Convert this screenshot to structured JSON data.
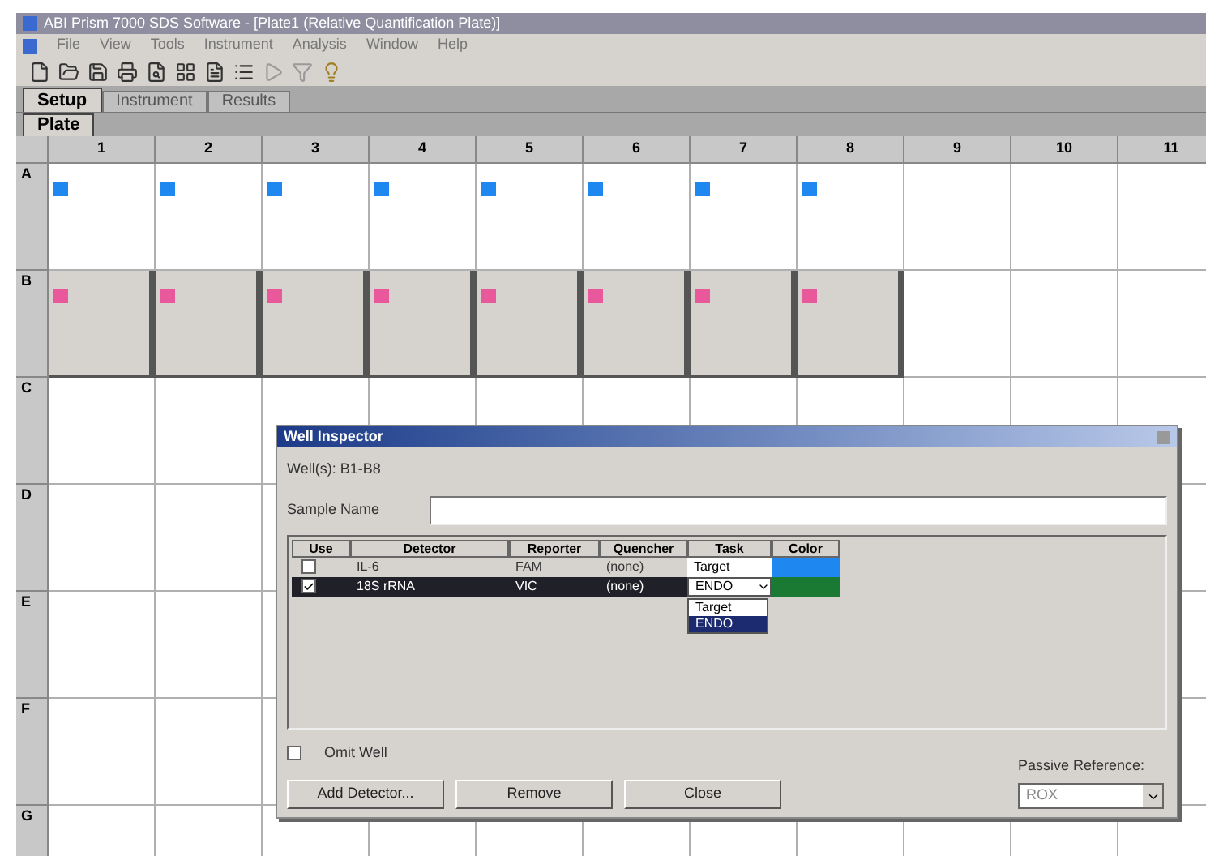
{
  "window": {
    "title": "ABI Prism 7000 SDS Software - [Plate1 (Relative Quantification Plate)]"
  },
  "menu": [
    "File",
    "View",
    "Tools",
    "Instrument",
    "Analysis",
    "Window",
    "Help"
  ],
  "tabs": [
    {
      "label": "Setup",
      "selected": true
    },
    {
      "label": "Instrument",
      "selected": false
    },
    {
      "label": "Results",
      "selected": false
    }
  ],
  "subtabs": [
    {
      "label": "Plate",
      "selected": true
    }
  ],
  "plate": {
    "columns": [
      "1",
      "2",
      "3",
      "4",
      "5",
      "6",
      "7",
      "8",
      "9",
      "10",
      "11"
    ],
    "rows": [
      {
        "label": "A",
        "wells": [
          {
            "kind": "target",
            "selected": false
          },
          {
            "kind": "target",
            "selected": false
          },
          {
            "kind": "target",
            "selected": false
          },
          {
            "kind": "target",
            "selected": false
          },
          {
            "kind": "target",
            "selected": false
          },
          {
            "kind": "target",
            "selected": false
          },
          {
            "kind": "target",
            "selected": false
          },
          {
            "kind": "target",
            "selected": false
          }
        ]
      },
      {
        "label": "B",
        "wells": [
          {
            "kind": "endo",
            "selected": true
          },
          {
            "kind": "endo",
            "selected": true
          },
          {
            "kind": "endo",
            "selected": true
          },
          {
            "kind": "endo",
            "selected": true
          },
          {
            "kind": "endo",
            "selected": true
          },
          {
            "kind": "endo",
            "selected": true
          },
          {
            "kind": "endo",
            "selected": true
          },
          {
            "kind": "endo",
            "selected": true
          }
        ]
      },
      {
        "label": "C"
      },
      {
        "label": "D"
      },
      {
        "label": "E"
      },
      {
        "label": "F"
      },
      {
        "label": "G"
      }
    ]
  },
  "dialog": {
    "title": "Well Inspector",
    "wells": "Well(s): B1-B8",
    "sample_name": {
      "label": "Sample Name"
    },
    "detectors": {
      "columns": [
        "Use",
        "Detector",
        "Reporter",
        "Quencher",
        "Task",
        "Color"
      ],
      "rows": [
        {
          "use": false,
          "detector": "IL-6",
          "reporter": "FAM",
          "quencher": "(none)",
          "task": "Target",
          "color": "#1e88f0",
          "selected": false
        },
        {
          "use": true,
          "detector": "18S rRNA",
          "reporter": "VIC",
          "quencher": "(none)",
          "task": "ENDO",
          "color": "#1a7a34",
          "selected": true
        }
      ],
      "task_options": [
        {
          "label": "Target",
          "selected": false
        },
        {
          "label": "ENDO",
          "selected": true
        }
      ]
    },
    "omit_well": {
      "label": "Omit Well",
      "checked": false
    },
    "buttons": [
      "Add Detector...",
      "Remove",
      "Close"
    ],
    "passive_reference": {
      "label": "Passive Reference:",
      "value": "ROX"
    }
  }
}
